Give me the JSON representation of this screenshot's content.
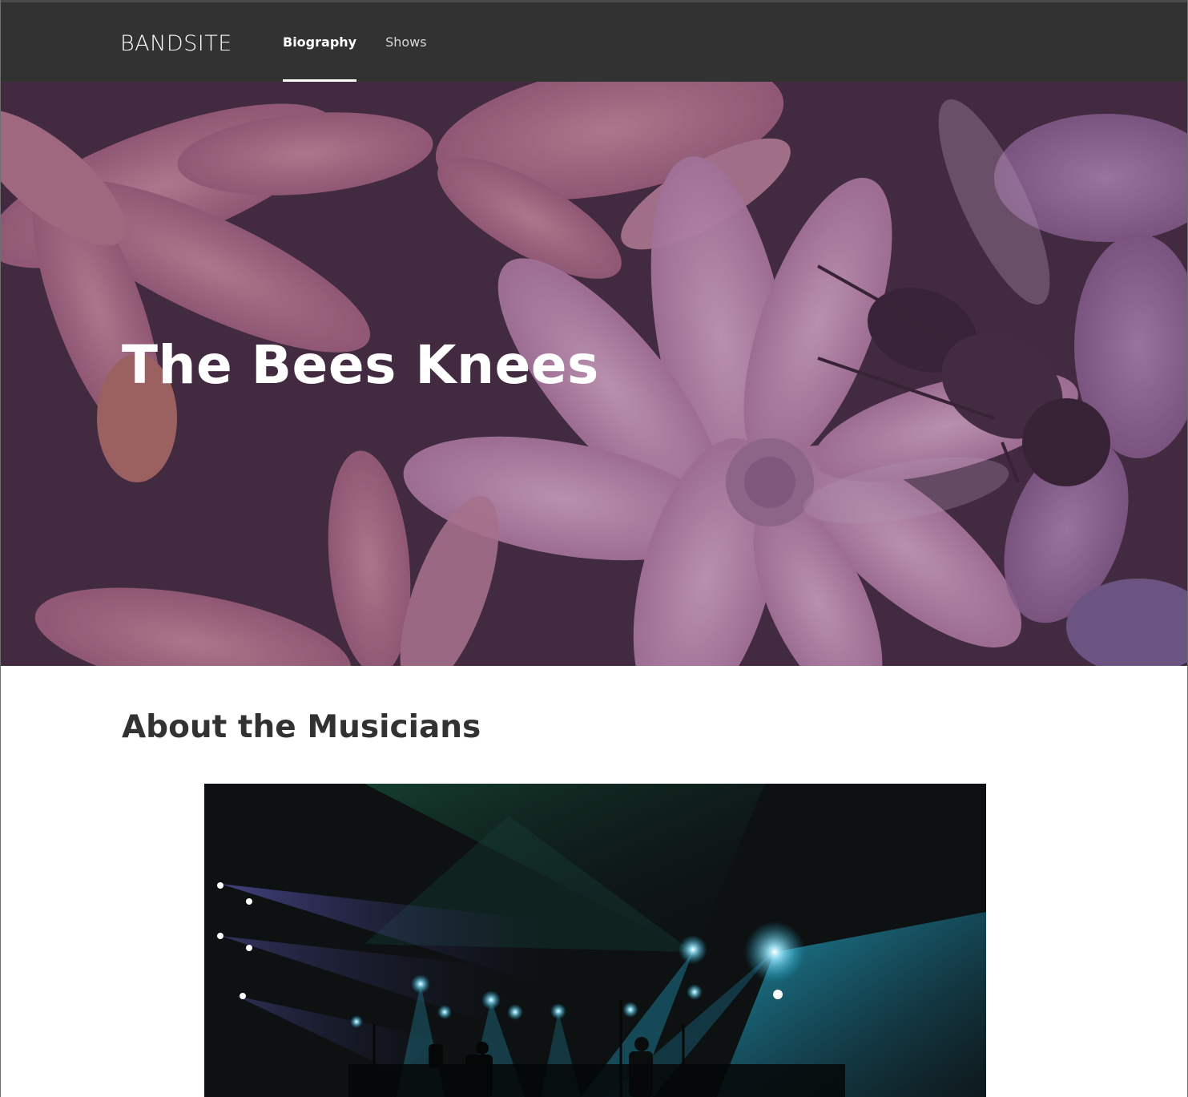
{
  "header": {
    "logo": "BANDSITE",
    "nav": [
      {
        "label": "Biography",
        "active": true
      },
      {
        "label": "Shows",
        "active": false
      }
    ]
  },
  "hero": {
    "title": "The Bees Knees",
    "image": "flowers-with-bee-photo"
  },
  "about": {
    "title": "About the Musicians",
    "image": "band-concert-stage-lights-photo"
  },
  "colors": {
    "header_bg": "#323232",
    "hero_tint": "#6d4a6e",
    "heading_text": "#323232",
    "white": "#ffffff"
  }
}
